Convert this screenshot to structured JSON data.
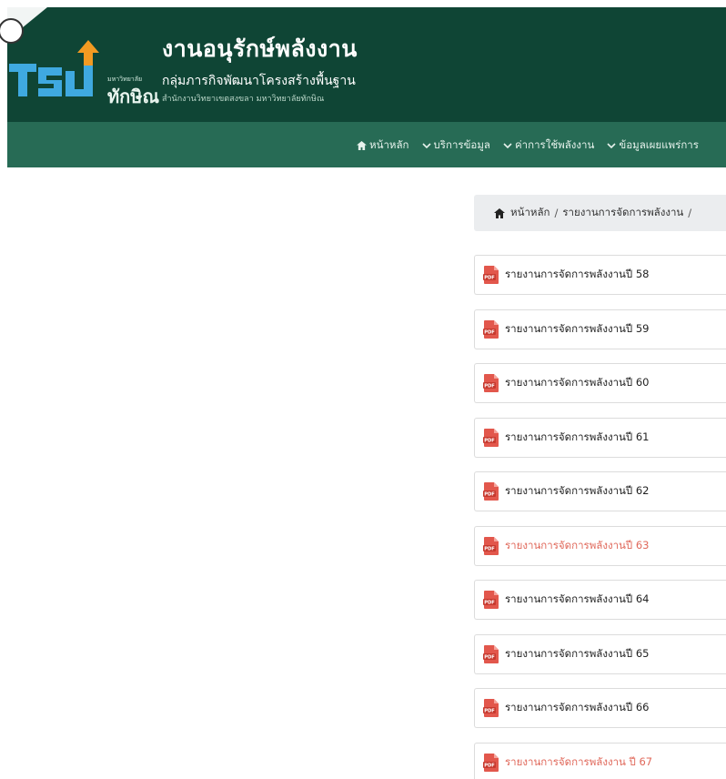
{
  "header": {
    "title": "งานอนุรักษ์พลังงาน",
    "subtitle": "กลุ่มภารกิจพัฒนาโครงสร้างพื้นฐาน",
    "subtitle2": "สำนักงานวิทยาเขตสงขลา มหาวิทยาลัยทักษิณ",
    "logo_letters": "TSU",
    "logo_small": "มหาวิทยาลัย",
    "logo_big": "ทักษิณ"
  },
  "colors": {
    "header_bg": "#0f4535",
    "nav_bg": "#276b55",
    "highlight": "#e0685a",
    "pdf_red": "#e2574c"
  },
  "nav": [
    {
      "label": "หน้าหลัก",
      "icon": "home-icon"
    },
    {
      "label": "บริการข้อมูล",
      "icon": "chevron-down-icon"
    },
    {
      "label": "ค่าการใช้พลังงาน",
      "icon": "chevron-down-icon"
    },
    {
      "label": "ข้อมูลเผยแพร่การ",
      "icon": "chevron-down-icon"
    }
  ],
  "breadcrumb": {
    "home": "หน้าหลัก",
    "current": "รายงานการจัดการพลังงาน",
    "sep": "/"
  },
  "reports": [
    {
      "label": "รายงานการจัดการพลังงานปี 58",
      "highlight": false
    },
    {
      "label": "รายงานการจัดการพลังงานปี 59",
      "highlight": false
    },
    {
      "label": "รายงานการจัดการพลังงานปี 60",
      "highlight": false
    },
    {
      "label": "รายงานการจัดการพลังงานปี 61",
      "highlight": false
    },
    {
      "label": "รายงานการจัดการพลังงานปี 62",
      "highlight": false
    },
    {
      "label": "รายงานการจัดการพลังงานปี 63",
      "highlight": true
    },
    {
      "label": "รายงานการจัดการพลังงานปี 64",
      "highlight": false
    },
    {
      "label": "รายงานการจัดการพลังงานปี 65",
      "highlight": false
    },
    {
      "label": "รายงานการจัดการพลังงานปี 66",
      "highlight": false
    },
    {
      "label": "รายงานการจัดการพลังงาน ปี 67",
      "highlight": true
    }
  ]
}
